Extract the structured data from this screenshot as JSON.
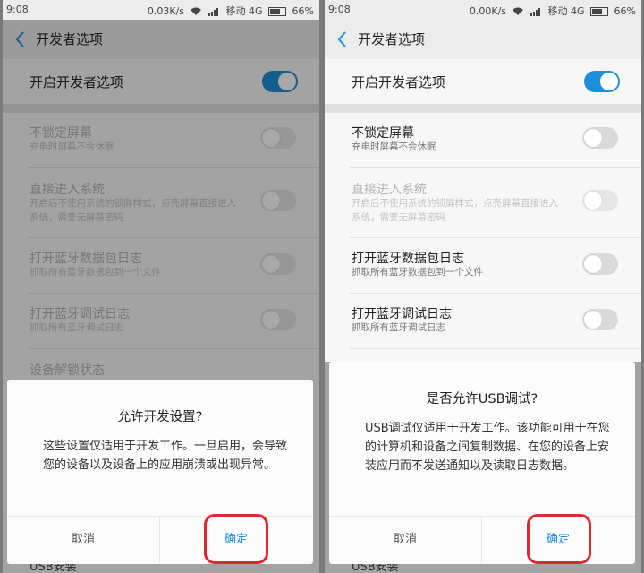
{
  "screens": [
    {
      "status": {
        "time": "9:08",
        "speed": "0.03K/s",
        "carrier": "移动 4G",
        "battery": "66%"
      },
      "header": {
        "title": "开发者选项"
      },
      "main_toggle": {
        "label": "开启开发者选项"
      },
      "items": [
        {
          "title": "不锁定屏幕",
          "subtitle": "充电时屏幕不会休眠"
        },
        {
          "title": "直接进入系统",
          "subtitle": "开启后不使用系统的锁屏样式，点亮屏幕直接进入系统，需要无屏幕密码"
        },
        {
          "title": "打开蓝牙数据包日志",
          "subtitle": "抓取所有蓝牙数据包到一个文件"
        },
        {
          "title": "打开蓝牙调试日志",
          "subtitle": "抓取所有蓝牙调试日志"
        },
        {
          "title": "设备解锁状态"
        }
      ],
      "dialog": {
        "title": "允许开发设置?",
        "body": "这些设置仅适用于开发工作。一旦启用，会导致您的设备以及设备上的应用崩溃或出现异常。",
        "cancel": "取消",
        "ok": "确定"
      },
      "bottom_peek": "USB安装"
    },
    {
      "status": {
        "time": "9:08",
        "speed": "0.00K/s",
        "carrier": "移动 4G",
        "battery": "66%"
      },
      "header": {
        "title": "开发者选项"
      },
      "main_toggle": {
        "label": "开启开发者选项"
      },
      "items": [
        {
          "title": "不锁定屏幕",
          "subtitle": "充电时屏幕不会休眠"
        },
        {
          "title": "直接进入系统",
          "subtitle": "开启后不使用系统的锁屏样式，点亮屏幕直接进入系统，需要无屏幕密码"
        },
        {
          "title": "打开蓝牙数据包日志",
          "subtitle": "抓取所有蓝牙数据包到一个文件"
        },
        {
          "title": "打开蓝牙调试日志",
          "subtitle": "抓取所有蓝牙调试日志"
        }
      ],
      "dialog": {
        "title": "是否允许USB调试?",
        "body": "USB调试仅适用于开发工作。该功能可用于在您的计算机和设备之间复制数据、在您的设备上安装应用而不发送通知以及读取日志数据。",
        "cancel": "取消",
        "ok": "确定"
      },
      "bottom_peek": "USB安装"
    }
  ],
  "colors": {
    "accent": "#1d8fd9",
    "highlight": "#e0262e"
  }
}
